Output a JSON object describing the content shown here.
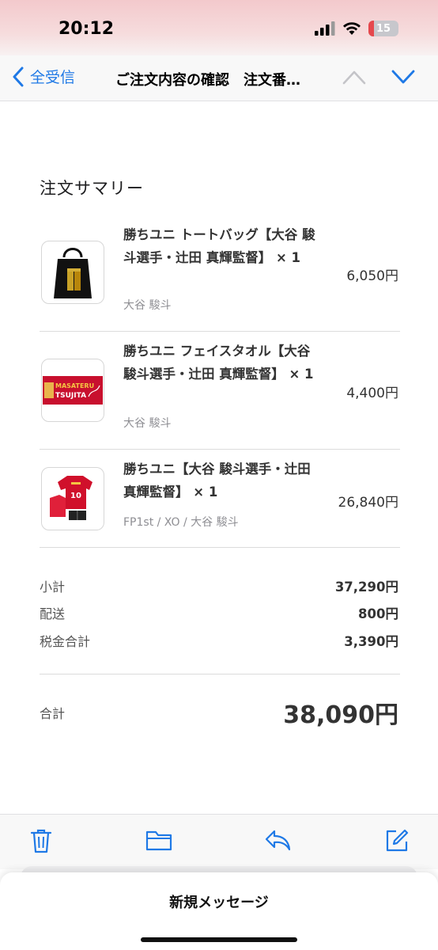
{
  "status": {
    "time": "20:12",
    "battery": "15"
  },
  "nav": {
    "back_label": "全受信",
    "title": "ご注文内容の確認　注文番…"
  },
  "order": {
    "section_title": "注文サマリー",
    "items": [
      {
        "name": "勝ちユニ トートバッグ【大谷 駿斗選手・辻田 真輝監督】 × 1",
        "sub": "大谷 駿斗",
        "price": "6,050円"
      },
      {
        "name": "勝ちユニ フェイスタオル【大谷 駿斗選手・辻田 真輝監督】 × 1",
        "sub": "大谷 駿斗",
        "price": "4,400円",
        "thumb_text": [
          "MASATERU",
          "TSUJITA"
        ]
      },
      {
        "name": "勝ちユニ【大谷 駿斗選手・辻田 真輝監督】 × 1",
        "sub": "FP1st / XO / 大谷 駿斗",
        "price": "26,840円"
      }
    ],
    "summary": [
      {
        "label": "小計",
        "value": "37,290円"
      },
      {
        "label": "配送",
        "value": "800円"
      },
      {
        "label": "税金合計",
        "value": "3,390円"
      }
    ],
    "total": {
      "label": "合計",
      "value": "38,090円"
    }
  },
  "toolbar": {
    "icons": [
      "trash-icon",
      "folder-icon",
      "reply-icon",
      "compose-icon"
    ]
  },
  "sheet": {
    "title": "新規メッセージ"
  },
  "colors": {
    "accent": "#1f79e6",
    "status_gradient_top": "#f3c9cc"
  }
}
